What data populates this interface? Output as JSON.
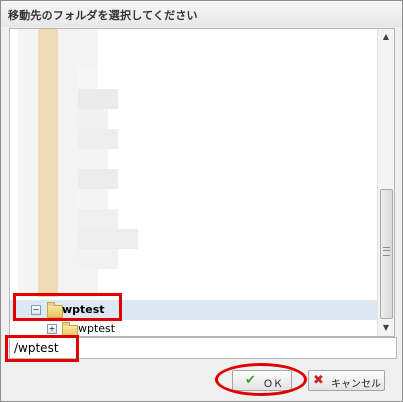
{
  "dialog": {
    "title": "移動先のフォルダを選択してください"
  },
  "tree": {
    "nodes": [
      {
        "label": "wptest",
        "expander": "−",
        "selected": true
      },
      {
        "label": "wptest",
        "expander": "+",
        "selected": false
      }
    ]
  },
  "path_input": {
    "value": "/wptest"
  },
  "buttons": {
    "ok_label": "ＯＫ",
    "cancel_label": "キャンセル"
  },
  "icons": {
    "ok": "check-icon",
    "cancel": "x-icon",
    "folder": "folder-icon",
    "scroll_up": "arrow-up-icon",
    "scroll_down": "arrow-down-icon"
  },
  "colors": {
    "highlight_annotation": "#e00000",
    "selection": "#dde8f5",
    "blur_tan": "#efdcb4"
  }
}
